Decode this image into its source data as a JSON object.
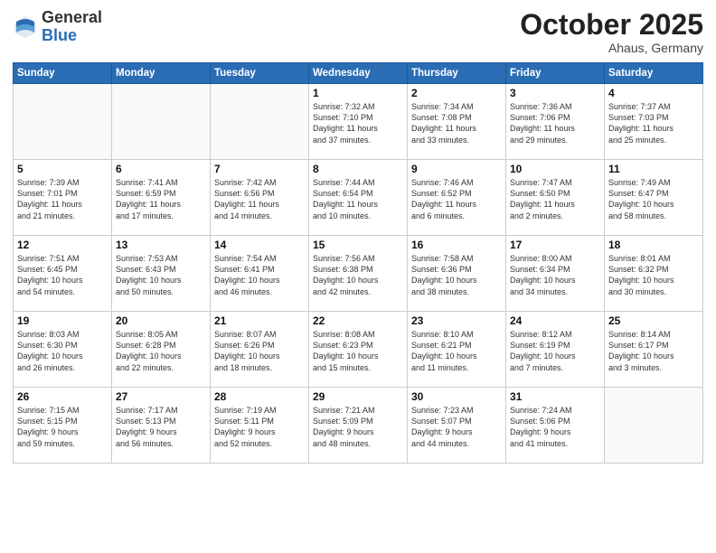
{
  "header": {
    "logo_general": "General",
    "logo_blue": "Blue",
    "month_title": "October 2025",
    "location": "Ahaus, Germany"
  },
  "weekdays": [
    "Sunday",
    "Monday",
    "Tuesday",
    "Wednesday",
    "Thursday",
    "Friday",
    "Saturday"
  ],
  "weeks": [
    [
      {
        "day": "",
        "info": ""
      },
      {
        "day": "",
        "info": ""
      },
      {
        "day": "",
        "info": ""
      },
      {
        "day": "1",
        "info": "Sunrise: 7:32 AM\nSunset: 7:10 PM\nDaylight: 11 hours\nand 37 minutes."
      },
      {
        "day": "2",
        "info": "Sunrise: 7:34 AM\nSunset: 7:08 PM\nDaylight: 11 hours\nand 33 minutes."
      },
      {
        "day": "3",
        "info": "Sunrise: 7:36 AM\nSunset: 7:06 PM\nDaylight: 11 hours\nand 29 minutes."
      },
      {
        "day": "4",
        "info": "Sunrise: 7:37 AM\nSunset: 7:03 PM\nDaylight: 11 hours\nand 25 minutes."
      }
    ],
    [
      {
        "day": "5",
        "info": "Sunrise: 7:39 AM\nSunset: 7:01 PM\nDaylight: 11 hours\nand 21 minutes."
      },
      {
        "day": "6",
        "info": "Sunrise: 7:41 AM\nSunset: 6:59 PM\nDaylight: 11 hours\nand 17 minutes."
      },
      {
        "day": "7",
        "info": "Sunrise: 7:42 AM\nSunset: 6:56 PM\nDaylight: 11 hours\nand 14 minutes."
      },
      {
        "day": "8",
        "info": "Sunrise: 7:44 AM\nSunset: 6:54 PM\nDaylight: 11 hours\nand 10 minutes."
      },
      {
        "day": "9",
        "info": "Sunrise: 7:46 AM\nSunset: 6:52 PM\nDaylight: 11 hours\nand 6 minutes."
      },
      {
        "day": "10",
        "info": "Sunrise: 7:47 AM\nSunset: 6:50 PM\nDaylight: 11 hours\nand 2 minutes."
      },
      {
        "day": "11",
        "info": "Sunrise: 7:49 AM\nSunset: 6:47 PM\nDaylight: 10 hours\nand 58 minutes."
      }
    ],
    [
      {
        "day": "12",
        "info": "Sunrise: 7:51 AM\nSunset: 6:45 PM\nDaylight: 10 hours\nand 54 minutes."
      },
      {
        "day": "13",
        "info": "Sunrise: 7:53 AM\nSunset: 6:43 PM\nDaylight: 10 hours\nand 50 minutes."
      },
      {
        "day": "14",
        "info": "Sunrise: 7:54 AM\nSunset: 6:41 PM\nDaylight: 10 hours\nand 46 minutes."
      },
      {
        "day": "15",
        "info": "Sunrise: 7:56 AM\nSunset: 6:38 PM\nDaylight: 10 hours\nand 42 minutes."
      },
      {
        "day": "16",
        "info": "Sunrise: 7:58 AM\nSunset: 6:36 PM\nDaylight: 10 hours\nand 38 minutes."
      },
      {
        "day": "17",
        "info": "Sunrise: 8:00 AM\nSunset: 6:34 PM\nDaylight: 10 hours\nand 34 minutes."
      },
      {
        "day": "18",
        "info": "Sunrise: 8:01 AM\nSunset: 6:32 PM\nDaylight: 10 hours\nand 30 minutes."
      }
    ],
    [
      {
        "day": "19",
        "info": "Sunrise: 8:03 AM\nSunset: 6:30 PM\nDaylight: 10 hours\nand 26 minutes."
      },
      {
        "day": "20",
        "info": "Sunrise: 8:05 AM\nSunset: 6:28 PM\nDaylight: 10 hours\nand 22 minutes."
      },
      {
        "day": "21",
        "info": "Sunrise: 8:07 AM\nSunset: 6:26 PM\nDaylight: 10 hours\nand 18 minutes."
      },
      {
        "day": "22",
        "info": "Sunrise: 8:08 AM\nSunset: 6:23 PM\nDaylight: 10 hours\nand 15 minutes."
      },
      {
        "day": "23",
        "info": "Sunrise: 8:10 AM\nSunset: 6:21 PM\nDaylight: 10 hours\nand 11 minutes."
      },
      {
        "day": "24",
        "info": "Sunrise: 8:12 AM\nSunset: 6:19 PM\nDaylight: 10 hours\nand 7 minutes."
      },
      {
        "day": "25",
        "info": "Sunrise: 8:14 AM\nSunset: 6:17 PM\nDaylight: 10 hours\nand 3 minutes."
      }
    ],
    [
      {
        "day": "26",
        "info": "Sunrise: 7:15 AM\nSunset: 5:15 PM\nDaylight: 9 hours\nand 59 minutes."
      },
      {
        "day": "27",
        "info": "Sunrise: 7:17 AM\nSunset: 5:13 PM\nDaylight: 9 hours\nand 56 minutes."
      },
      {
        "day": "28",
        "info": "Sunrise: 7:19 AM\nSunset: 5:11 PM\nDaylight: 9 hours\nand 52 minutes."
      },
      {
        "day": "29",
        "info": "Sunrise: 7:21 AM\nSunset: 5:09 PM\nDaylight: 9 hours\nand 48 minutes."
      },
      {
        "day": "30",
        "info": "Sunrise: 7:23 AM\nSunset: 5:07 PM\nDaylight: 9 hours\nand 44 minutes."
      },
      {
        "day": "31",
        "info": "Sunrise: 7:24 AM\nSunset: 5:06 PM\nDaylight: 9 hours\nand 41 minutes."
      },
      {
        "day": "",
        "info": ""
      }
    ]
  ]
}
